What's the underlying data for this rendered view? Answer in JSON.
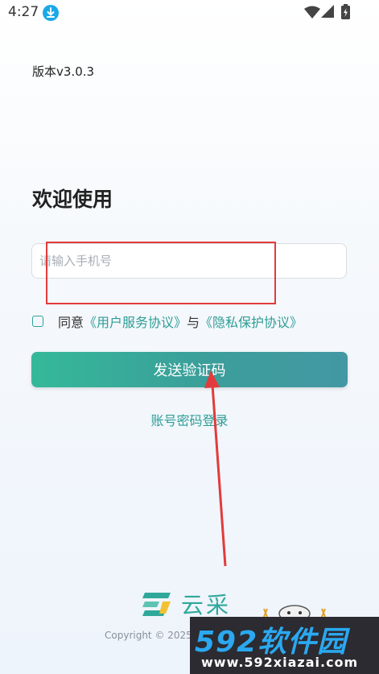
{
  "status_bar": {
    "time": "4:27"
  },
  "version": "版本v3.0.3",
  "title": "欢迎使用",
  "phone_input": {
    "placeholder": "请输入手机号",
    "value": ""
  },
  "agreement": {
    "prefix": "同意",
    "user_agreement": "《用户服务协议》",
    "connector": "与",
    "privacy_agreement": "《隐私保护协议》",
    "checked": false
  },
  "send_code_button": "发送验证码",
  "password_login_link": "账号密码登录",
  "footer": {
    "brand": "云采",
    "copyright": "Copyright © 2025"
  },
  "watermark": {
    "big": "592软件园",
    "small": "www.592xiazai.com"
  },
  "colors": {
    "accent": "#2e9d96",
    "button_start": "#35b999",
    "button_end": "#4398a3",
    "annotation": "#e23b3b"
  }
}
